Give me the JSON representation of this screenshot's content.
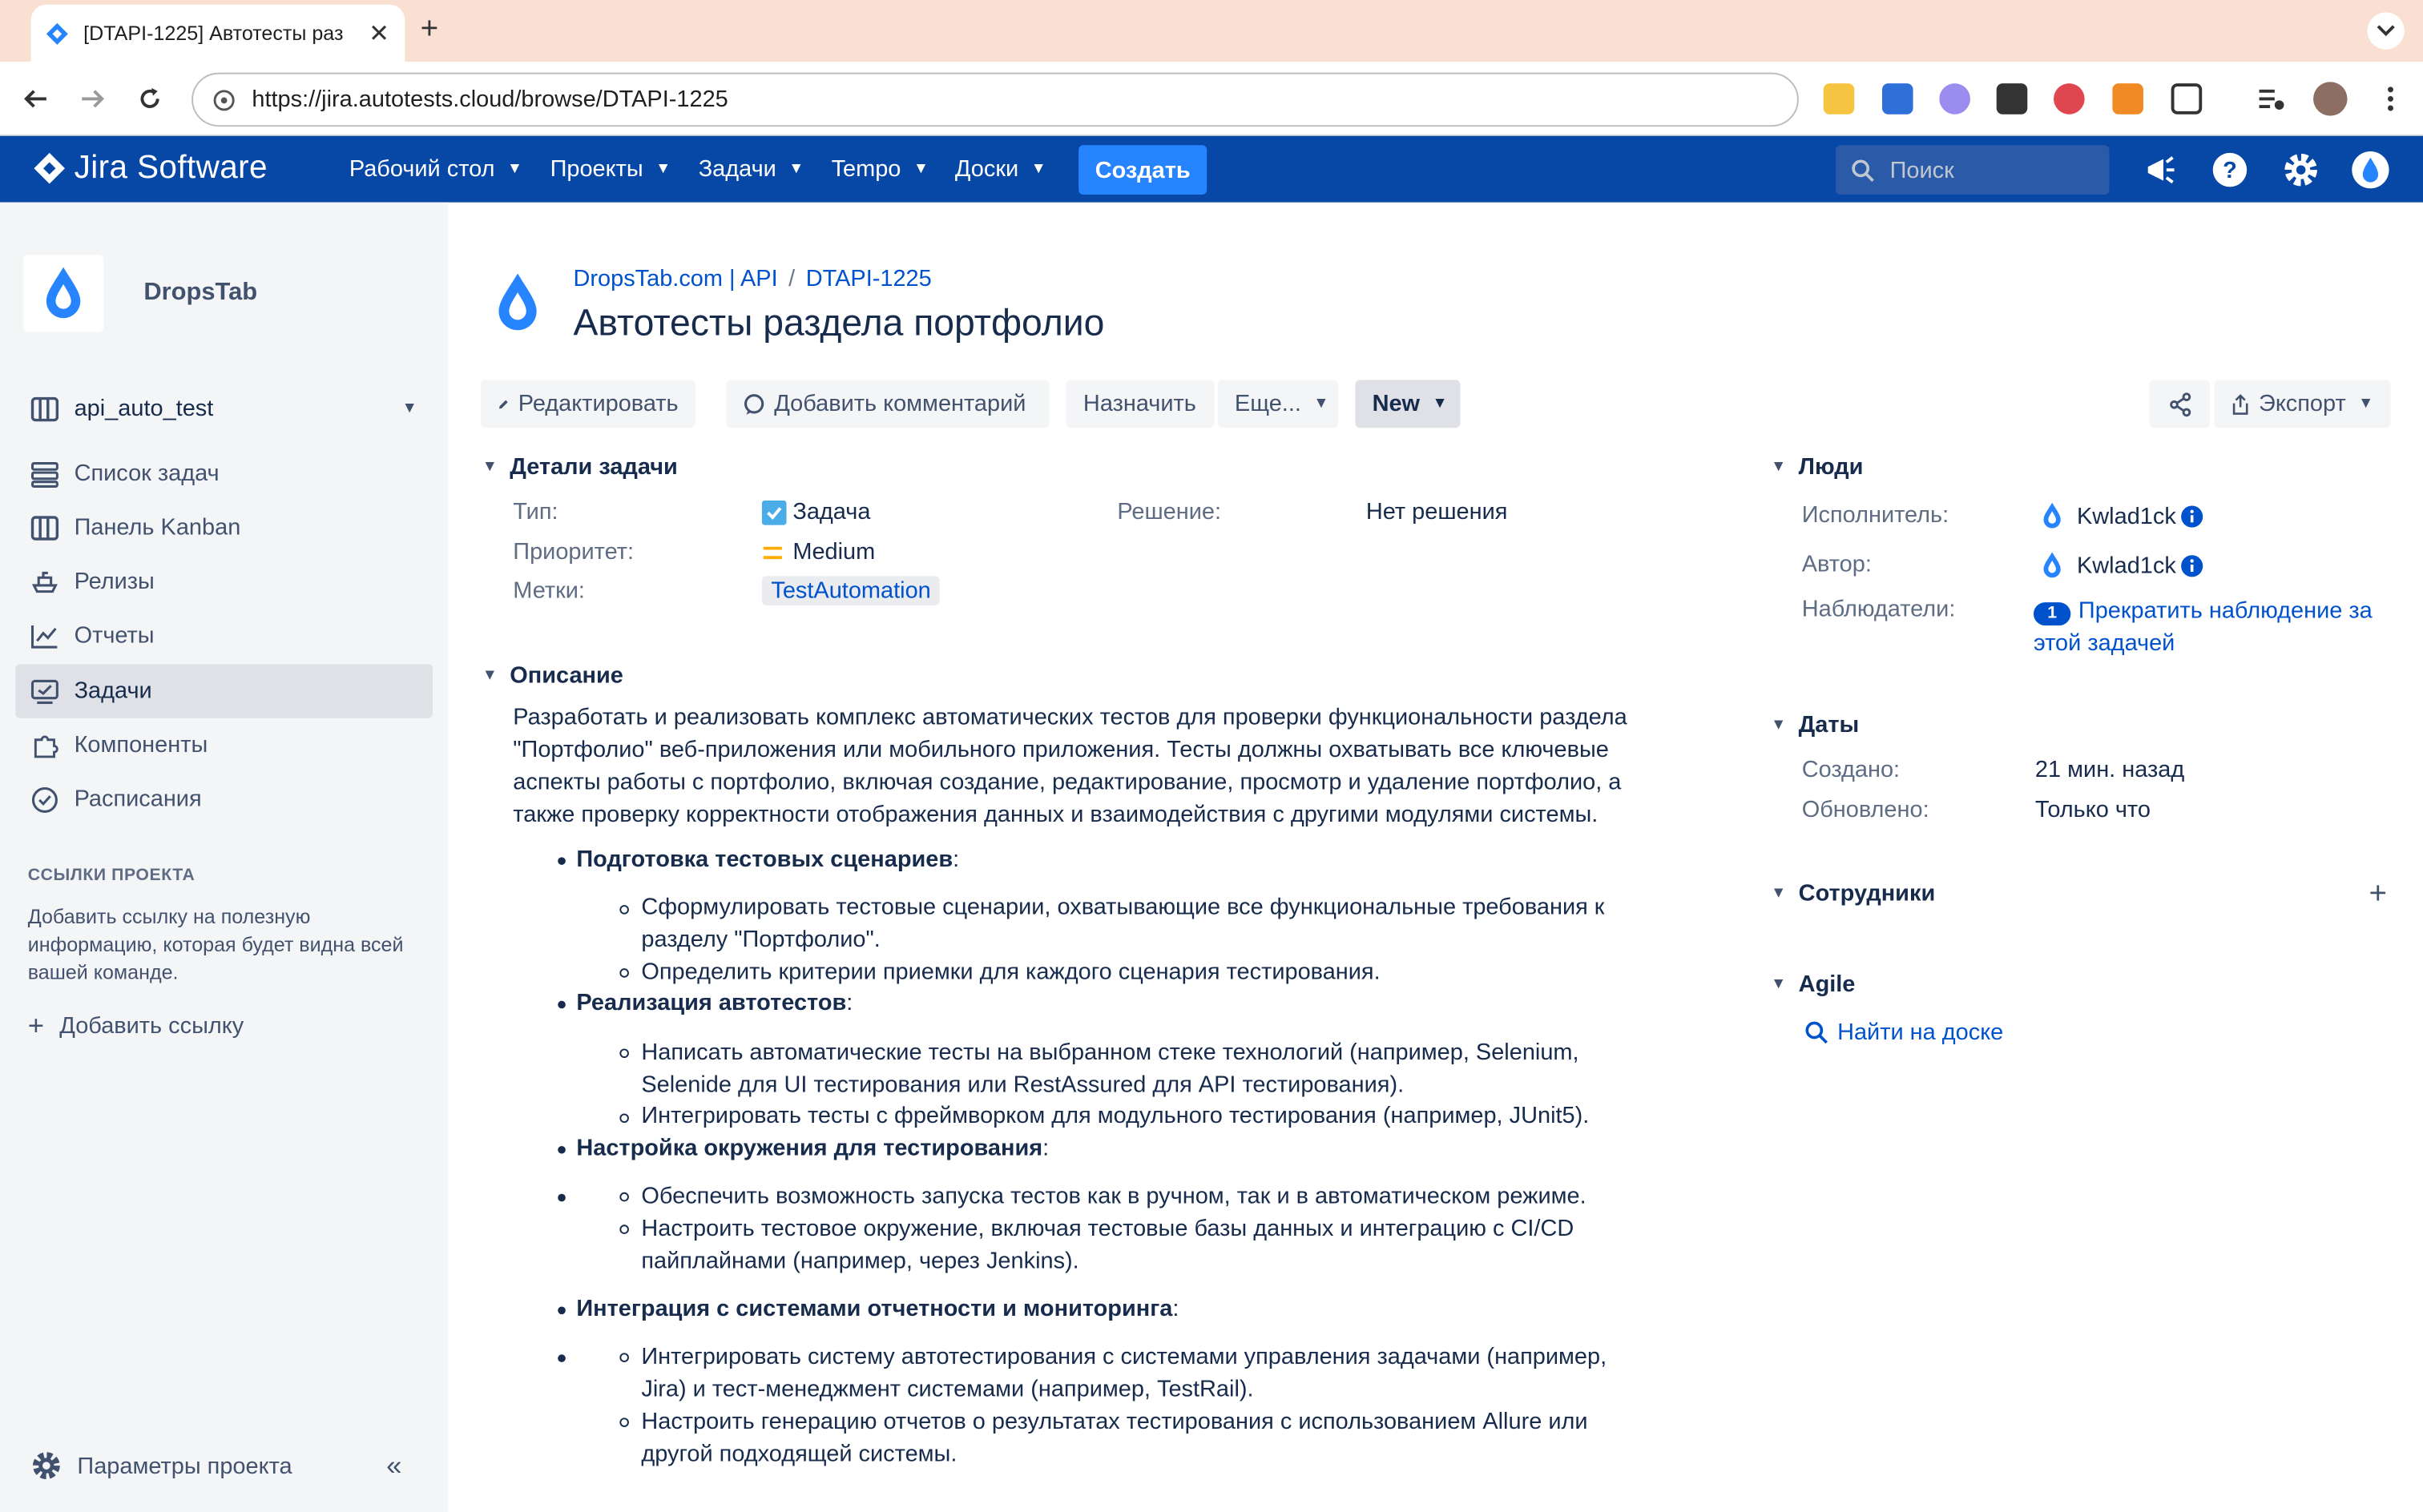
{
  "browser": {
    "tab_title": "[DTAPI-1225] Автотесты раз",
    "url": "https://jira.autotests.cloud/browse/DTAPI-1225"
  },
  "header": {
    "logo_text": "Jira Software",
    "menu": [
      "Рабочий стол",
      "Проекты",
      "Задачи",
      "Tempo",
      "Доски"
    ],
    "create_label": "Создать",
    "search_placeholder": "Поиск"
  },
  "sidebar": {
    "project_name": "DropsTab",
    "board_selector": "api_auto_test",
    "items": [
      "Список задач",
      "Панель Kanban",
      "Релизы",
      "Отчеты",
      "Задачи",
      "Компоненты",
      "Расписания"
    ],
    "selected_index": 4,
    "links_heading": "ССЫЛКИ ПРОЕКТА",
    "links_text": "Добавить ссылку на полезную информацию, которая будет видна всей вашей команде.",
    "add_link": "Добавить ссылку",
    "settings": "Параметры проекта"
  },
  "issue": {
    "breadcrumb_project": "DropsTab.com | API",
    "breadcrumb_key": "DTAPI-1225",
    "title": "Автотесты раздела портфолио",
    "actions": {
      "edit": "Редактировать",
      "comment": "Добавить комментарий",
      "assign": "Назначить",
      "more": "Еще...",
      "status": "New",
      "export": "Экспорт"
    },
    "details": {
      "heading": "Детали задачи",
      "type_label": "Тип:",
      "type_value": "Задача",
      "priority_label": "Приоритет:",
      "priority_value": "Medium",
      "labels_label": "Метки:",
      "labels_value": "TestAutomation",
      "resolution_label": "Решение:",
      "resolution_value": "Нет решения"
    },
    "description": {
      "heading": "Описание",
      "intro": "Разработать и реализовать комплекс автоматических тестов для проверки функциональности раздела \"Портфолио\" веб-приложения или мобильного приложения. Тесты должны охватывать все ключевые аспекты работы с портфолио, включая создание, редактирование, просмотр и удаление портфолио, а также проверку корректности отображения данных и взаимодействия с другими модулями системы.",
      "sections": [
        {
          "title": "Подготовка тестовых сценариев",
          "items": [
            "Сформулировать тестовые сценарии, охватывающие все функциональные требования к разделу \"Портфолио\".",
            "Определить критерии приемки для каждого сценария тестирования."
          ]
        },
        {
          "title": "Реализация автотестов",
          "items": [
            "Написать автоматические тесты на выбранном стеке технологий (например, Selenium, Selenide для UI тестирования или RestAssured для API тестирования).",
            "Интегрировать тесты с фреймворком для модульного тестирования (например, JUnit5)."
          ]
        },
        {
          "title": "Настройка окружения для тестирования",
          "items": [
            "Обеспечить возможность запуска тестов как в ручном, так и в автоматическом режиме.",
            "Настроить тестовое окружение, включая тестовые базы данных и интеграцию с CI/CD пайплайнами (например, через Jenkins)."
          ]
        },
        {
          "title": "Интеграция с системами отчетности и мониторинга",
          "items": [
            "Интегрировать систему автотестирования с системами управления задачами (например, Jira) и тест-менеджмент системами (например, TestRail).",
            "Настроить генерацию отчетов о результатах тестирования с использованием Allure или другой подходящей системы."
          ]
        }
      ]
    },
    "people": {
      "heading": "Люди",
      "assignee_label": "Исполнитель:",
      "assignee": "Kwlad1ck",
      "reporter_label": "Автор:",
      "reporter": "Kwlad1ck",
      "watchers_label": "Наблюдатели:",
      "watchers_count": "1",
      "watch_action": "Прекратить наблюдение за этой задачей"
    },
    "dates": {
      "heading": "Даты",
      "created_label": "Создано:",
      "created": "21 мин. назад",
      "updated_label": "Обновлено:",
      "updated": "Только что"
    },
    "employees_heading": "Сотрудники",
    "agile": {
      "heading": "Agile",
      "find_on_board": "Найти на доске"
    }
  },
  "colors": {
    "header_bg": "#0747a6",
    "create_button": "#2684ff",
    "link": "#0052cc",
    "tab_strip": "#f9e0d2"
  }
}
